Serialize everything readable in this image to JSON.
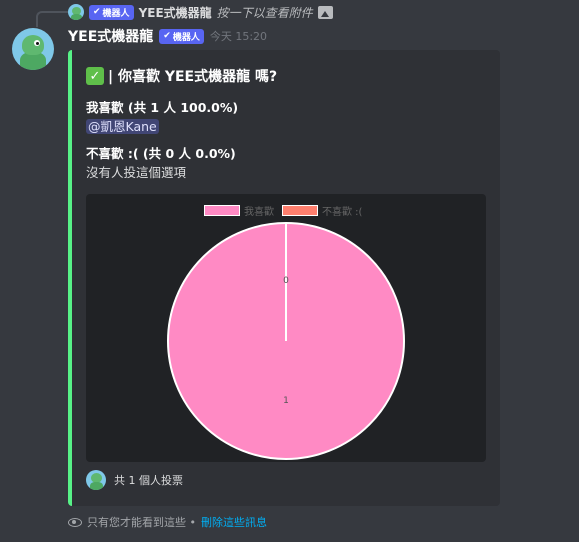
{
  "reply": {
    "author": "YEE式機器龍",
    "bot_tag": "機器人",
    "text": "按一下以查看附件"
  },
  "message": {
    "author": "YEE式機器龍",
    "bot_tag": "機器人",
    "timestamp": "今天 15:20"
  },
  "embed": {
    "accent_color": "#57f287",
    "title": "| 你喜歡 YEE式機器龍 嗎?",
    "fields": [
      {
        "name": "我喜歡 (共 1 人 100.0%)",
        "value": "@凱恩Kane"
      },
      {
        "name": "不喜歡 :( (共 0 人 0.0%)",
        "value": "沒有人投這個選項"
      }
    ],
    "footer": "共 1 個人投票"
  },
  "chart_data": {
    "type": "pie",
    "categories": [
      "我喜歡",
      "不喜歡 :("
    ],
    "values": [
      1,
      0
    ],
    "data_labels": [
      "1",
      "0"
    ],
    "colors": [
      "#ff8ac4",
      "#ff7f6e"
    ],
    "legend": "top"
  },
  "ephemeral": {
    "text": "只有您才能看到這些 •",
    "dismiss_label": "刪除這些訊息"
  }
}
